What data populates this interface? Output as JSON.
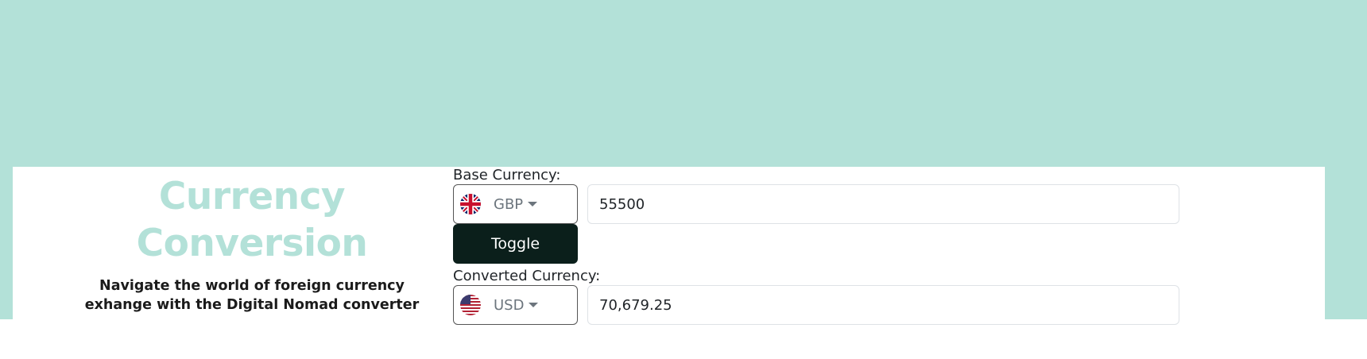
{
  "hero": {
    "title_line1": "Currency",
    "title_line2": "Conversion",
    "subtitle_line1": "Navigate the world of foreign currency",
    "subtitle_line2": "exhange with the Digital Nomad converter"
  },
  "base": {
    "label": "Base Currency:",
    "currency_code": "GBP",
    "flag_icon": "uk-flag-icon",
    "amount": "55500"
  },
  "toggle": {
    "label": "Toggle"
  },
  "converted": {
    "label": "Converted Currency:",
    "currency_code": "USD",
    "flag_icon": "us-flag-icon",
    "amount": "70,679.25"
  },
  "colors": {
    "accent": "#b3e1d8",
    "button_bg": "#0b1f1b",
    "button_text": "#ffffff"
  }
}
